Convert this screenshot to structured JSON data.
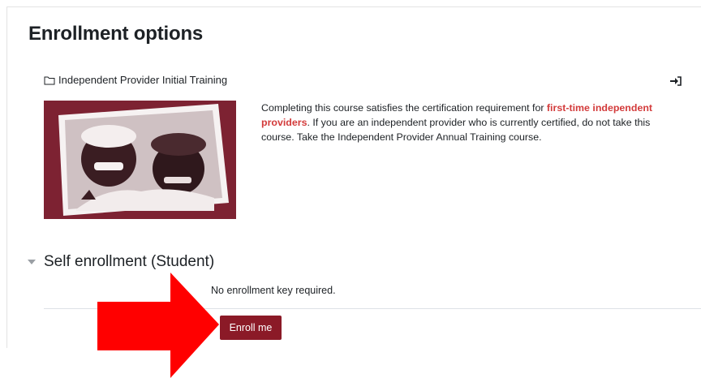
{
  "page": {
    "title": "Enrollment options"
  },
  "course": {
    "name": "Independent Provider Initial Training",
    "folder_icon": "folder-icon",
    "enter_icon": "enter-icon",
    "summary": {
      "part1": "Completing this course satisfies the certification requirement for ",
      "highlight": "first-time independent providers",
      "part2": ". If you are an independent provider who is currently certified, do not take this course. Take the ",
      "link": "Independent Provider Annual Training",
      "part3": " course."
    }
  },
  "enrollment": {
    "section_title": "Self enrollment (Student)",
    "no_key_text": "No enrollment key required.",
    "enroll_button": "Enroll me"
  },
  "colors": {
    "brand": "#8b1a27",
    "highlight": "#d33b3b",
    "arrow": "#ff0000"
  }
}
